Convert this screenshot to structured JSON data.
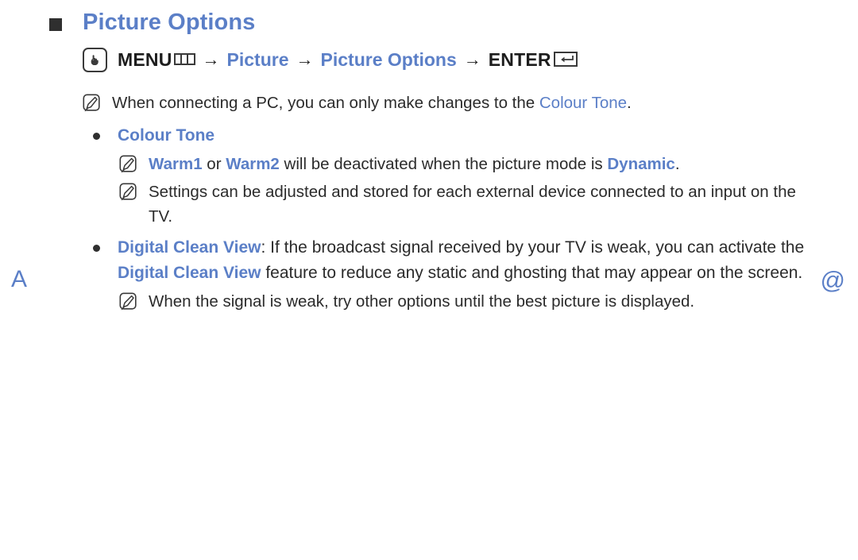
{
  "page": {
    "heading": "Picture Options",
    "edge_marker_left": "A",
    "edge_marker_right": "@"
  },
  "menu_path": {
    "key_icon": "menu-key-icon",
    "menu_label": "MENU",
    "menu_bars_icon": "menu-bars-icon",
    "arrow": "→",
    "step1": "Picture",
    "step2": "Picture Options",
    "enter_label": "ENTER",
    "enter_icon": "enter-return-icon"
  },
  "notes": {
    "pc_note": {
      "icon": "note-pen-icon",
      "text_before": "When connecting a PC, you can only make changes to the ",
      "highlight": "Colour Tone",
      "text_after": "."
    },
    "warm_note": {
      "icon": "note-pen-icon",
      "highlight1": "Warm1",
      "mid": " or ",
      "highlight2": "Warm2",
      "text_after": " will be deactivated when the picture mode is ",
      "highlight3": "Dynamic",
      "period": "."
    },
    "settings_note": {
      "icon": "note-pen-icon",
      "text": "Settings can be adjusted and stored for each external device connected to an input on the TV."
    },
    "weak_signal_note": {
      "icon": "note-pen-icon",
      "text": "When the signal is weak, try other options until the best picture is displayed."
    }
  },
  "bullets": {
    "colour_tone": {
      "label": "Colour Tone"
    },
    "digital_clean_view": {
      "label": "Digital Clean View",
      "text_after_label": ": If the broadcast signal received by your TV is weak, you can activate the ",
      "highlight": "Digital Clean View",
      "text_end": " feature to reduce any static and ghosting that may appear on the screen."
    }
  },
  "colors": {
    "accent_blue": "#5b7fc7",
    "body_text": "#2b2b2b",
    "icon_outline": "#3a3a3a"
  }
}
